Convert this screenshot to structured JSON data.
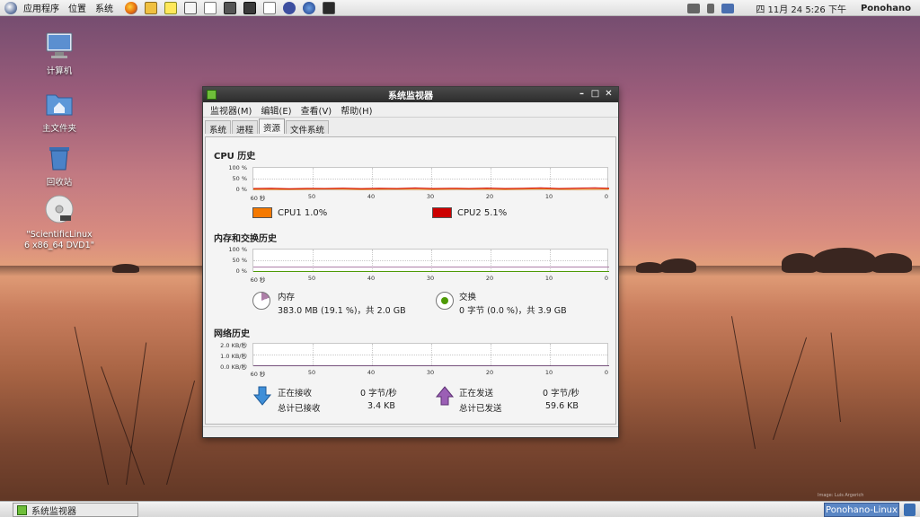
{
  "top_panel": {
    "menus": [
      "应用程序",
      "位置",
      "系统"
    ],
    "launchers": [
      "firefox-icon",
      "mail-icon",
      "notes-icon",
      "dictionary-icon",
      "screenshot-icon",
      "calculator-icon",
      "text-editor-icon",
      "eclipse-icon",
      "network-icon",
      "terminal-icon"
    ],
    "clock": "四 11月 24 5:26 下午",
    "user": "Ponohano"
  },
  "desktop": {
    "icons": [
      {
        "name": "computer-icon",
        "label": "计算机"
      },
      {
        "name": "home-folder-icon",
        "label": "主文件夹"
      },
      {
        "name": "trash-icon",
        "label": "回收站"
      },
      {
        "name": "dvd-icon",
        "label": "\"ScientificLinux 6 x86_64 DVD1\""
      }
    ]
  },
  "window": {
    "title": "系统监视器",
    "menu": [
      "监视器(M)",
      "编辑(E)",
      "查看(V)",
      "帮助(H)"
    ],
    "tabs": [
      "系统",
      "进程",
      "资源",
      "文件系统"
    ],
    "active_tab": "资源",
    "cpu": {
      "title": "CPU 历史",
      "y_ticks": [
        "100 %",
        "50 %",
        "0 %"
      ],
      "x_ticks": [
        "60 秒",
        "50",
        "40",
        "30",
        "20",
        "10",
        "0"
      ],
      "legend": [
        {
          "label": "CPU1  1.0%",
          "color": "#f57900"
        },
        {
          "label": "CPU2  5.1%",
          "color": "#cc0000"
        }
      ]
    },
    "memory": {
      "title": "内存和交换历史",
      "y_ticks": [
        "100 %",
        "50 %",
        "0 %"
      ],
      "x_ticks": [
        "60 秒",
        "50",
        "40",
        "30",
        "20",
        "10",
        "0"
      ],
      "mem_label": "内存",
      "mem_value": "383.0 MB (19.1 %)，共 2.0 GB",
      "swap_label": "交换",
      "swap_value": "0 字节 (0.0 %)，共 3.9 GB",
      "mem_fraction": 0.191,
      "swap_fraction": 0.0
    },
    "network": {
      "title": "网络历史",
      "y_ticks": [
        "2.0 KB/秒",
        "1.0 KB/秒",
        "0.0 KB/秒"
      ],
      "x_ticks": [
        "60 秒",
        "50",
        "40",
        "30",
        "20",
        "10",
        "0"
      ],
      "recv_label": "正在接收",
      "recv_rate": "0 字节/秒",
      "recv_total_label": "总计已接收",
      "recv_total": "3.4 KB",
      "send_label": "正在发送",
      "send_rate": "0 字节/秒",
      "send_total_label": "总计已发送",
      "send_total": "59.6 KB"
    }
  },
  "bottom_panel": {
    "task_label": "系统监视器",
    "workspace_label": "Ponohano-Linux"
  },
  "credit": "Image: Luis Argerich",
  "colors": {
    "cpu1": "#f57900",
    "cpu2": "#cc0000",
    "memory": "#ad7fa8",
    "swap": "#4e9a06",
    "network": "#75507b"
  }
}
